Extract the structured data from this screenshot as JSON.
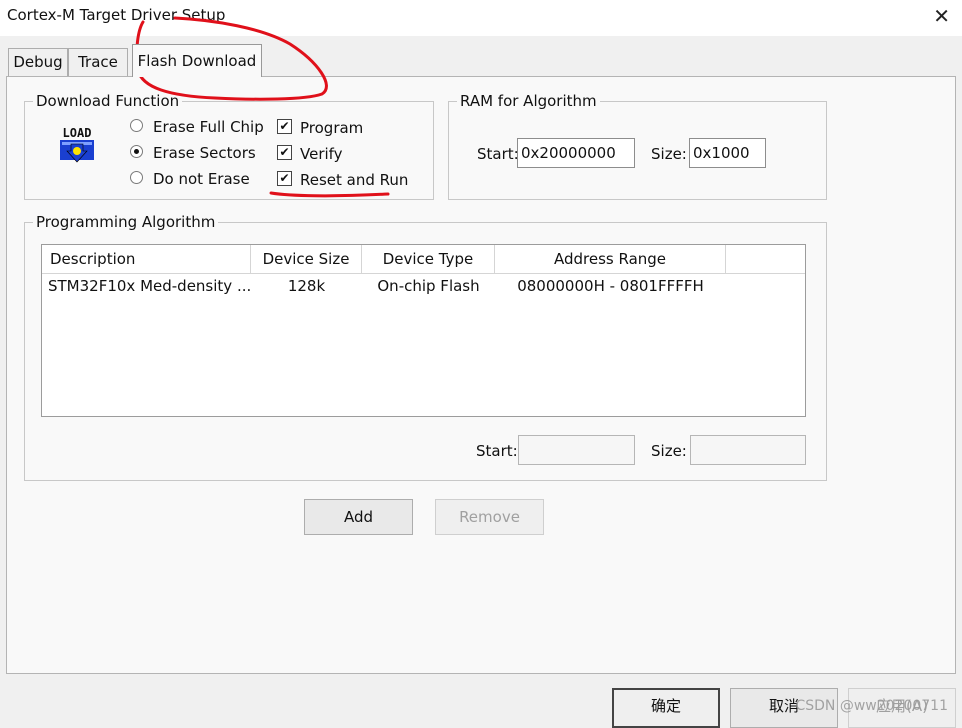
{
  "window": {
    "title": "Cortex-M Target Driver Setup",
    "close_glyph": "✕"
  },
  "tabs": [
    {
      "label": "Debug"
    },
    {
      "label": "Trace"
    },
    {
      "label": "Flash Download"
    }
  ],
  "download_function": {
    "title": "Download Function",
    "icon_label": "LOAD",
    "radios": [
      {
        "label": "Erase Full Chip",
        "selected": false
      },
      {
        "label": "Erase Sectors",
        "selected": true
      },
      {
        "label": "Do not Erase",
        "selected": false
      }
    ],
    "checks": [
      {
        "label": "Program",
        "checked": true,
        "mark": "✔"
      },
      {
        "label": "Verify",
        "checked": true,
        "mark": "✔"
      },
      {
        "label": "Reset and Run",
        "checked": true,
        "mark": "✔"
      }
    ]
  },
  "ram": {
    "title": "RAM for Algorithm",
    "start_label": "Start:",
    "start_value": "0x20000000",
    "size_label": "Size:",
    "size_value": "0x1000"
  },
  "programming_algorithm": {
    "title": "Programming Algorithm",
    "columns": [
      "Description",
      "Device Size",
      "Device Type",
      "Address Range"
    ],
    "rows": [
      [
        "STM32F10x Med-density ...",
        "128k",
        "On-chip Flash",
        "08000000H - 0801FFFFH"
      ]
    ],
    "start_label": "Start:",
    "start_value": "",
    "size_label": "Size:",
    "size_value": ""
  },
  "buttons": {
    "add": "Add",
    "remove": "Remove",
    "ok": "确定",
    "cancel": "取消",
    "apply": "应用(A)"
  },
  "watermark": "CSDN @ww20200711",
  "colors": {
    "annotation": "#e0101a"
  }
}
